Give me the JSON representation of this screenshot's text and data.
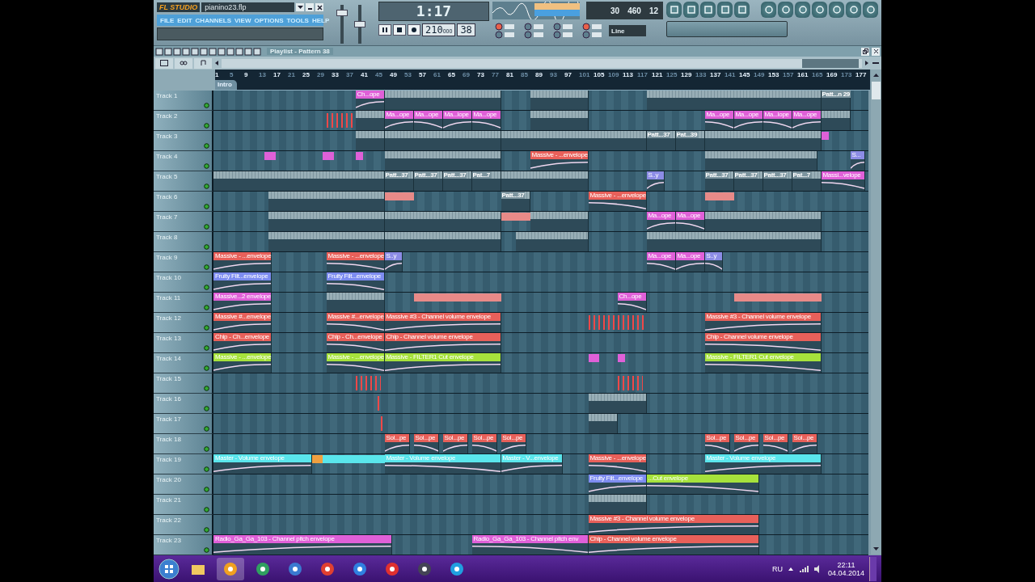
{
  "app": {
    "logo": "FL STUDIO",
    "file": "pianino23.flp",
    "menu": [
      "FILE",
      "EDIT",
      "CHANNELS",
      "VIEW",
      "OPTIONS",
      "TOOLS",
      "HELP"
    ]
  },
  "master": {
    "volume": {
      "level": 0.85
    },
    "pitch": {
      "level": 0.5
    }
  },
  "transport": {
    "song_position": "1:17",
    "tempo": "210",
    "tempo_fraction": "000",
    "pattern": "38"
  },
  "performance": {
    "readout_1": "30",
    "readout_2": "460",
    "readout_3": "12"
  },
  "snap": "Line",
  "playlist": {
    "title": "Playlist - Pattern 38",
    "ruler": [
      "1",
      "5",
      "9",
      "13",
      "17",
      "21",
      "25",
      "29",
      "33",
      "37",
      "41",
      "45",
      "49",
      "53",
      "57",
      "61",
      "65",
      "69",
      "73",
      "77",
      "81",
      "85",
      "89",
      "93",
      "97",
      "101",
      "105",
      "109",
      "113",
      "117",
      "121",
      "125",
      "129",
      "133",
      "137",
      "141",
      "145",
      "149",
      "153",
      "157",
      "161",
      "165",
      "169",
      "173",
      "177"
    ],
    "markers": [
      {
        "label": "Intro"
      }
    ],
    "tracks": [
      {
        "name": "Track 1",
        "clips": [
          {
            "kind": "envelope",
            "label": "Ch...ope",
            "color": "#e060d8"
          },
          {
            "kind": "pattern"
          },
          {
            "kind": "pattern"
          },
          {
            "kind": "pattern"
          },
          {
            "kind": "pattern",
            "label": "Patt...n 29"
          }
        ]
      },
      {
        "name": "Track 2",
        "clips": [
          {
            "kind": "notes"
          },
          {
            "kind": "pattern"
          },
          {
            "kind": "envelope",
            "label": "Ma...ope",
            "color": "#e060d8"
          },
          {
            "kind": "envelope",
            "label": "Ma...ope",
            "color": "#e060d8"
          },
          {
            "kind": "envelope",
            "label": "Ma...lope",
            "color": "#e060d8"
          },
          {
            "kind": "envelope",
            "label": "Ma...ope",
            "color": "#e060d8"
          },
          {
            "kind": "pattern"
          },
          {
            "kind": "envelope",
            "label": "Ma...ope",
            "color": "#e060d8"
          },
          {
            "kind": "envelope",
            "label": "Ma...ope",
            "color": "#e060d8"
          },
          {
            "kind": "envelope",
            "label": "Ma...lope",
            "color": "#e060d8"
          },
          {
            "kind": "envelope",
            "label": "Ma...ope",
            "color": "#e060d8"
          },
          {
            "kind": "pattern"
          }
        ]
      },
      {
        "name": "Track 3",
        "clips": [
          {
            "kind": "pattern"
          },
          {
            "kind": "pattern"
          },
          {
            "kind": "pattern"
          },
          {
            "kind": "pattern",
            "label": "Patt...37"
          },
          {
            "kind": "pattern",
            "label": "Pat...39"
          },
          {
            "kind": "pattern"
          },
          {
            "kind": "block",
            "color": "#e060d8"
          }
        ]
      },
      {
        "name": "Track 4",
        "clips": [
          {
            "kind": "block",
            "color": "#e060d8"
          },
          {
            "kind": "block",
            "color": "#e060d8"
          },
          {
            "kind": "block",
            "color": "#e060d8"
          },
          {
            "kind": "pattern"
          },
          {
            "kind": "envelope",
            "label": "Massive - ...envelope",
            "color": "#e8605a"
          },
          {
            "kind": "pattern"
          },
          {
            "kind": "envelope",
            "label": "S...",
            "color": "#8c8ce6"
          }
        ]
      },
      {
        "name": "Track 5",
        "clips": [
          {
            "kind": "pattern"
          },
          {
            "kind": "pattern",
            "label": "Patt...37"
          },
          {
            "kind": "pattern",
            "label": "Patt...37"
          },
          {
            "kind": "pattern",
            "label": "Patt...37"
          },
          {
            "kind": "pattern",
            "label": "Pat...7"
          },
          {
            "kind": "pattern"
          },
          {
            "kind": "envelope",
            "label": "S..y",
            "color": "#8c8ce6"
          },
          {
            "kind": "pattern",
            "label": "Patt...37"
          },
          {
            "kind": "pattern",
            "label": "Patt...37"
          },
          {
            "kind": "pattern",
            "label": "Patt...37"
          },
          {
            "kind": "pattern",
            "label": "Pat...7"
          },
          {
            "kind": "envelope",
            "label": "Massi...velope",
            "color": "#e060d8"
          }
        ]
      },
      {
        "name": "Track 6",
        "clips": [
          {
            "kind": "pattern"
          },
          {
            "kind": "block",
            "color": "#e88a88"
          },
          {
            "kind": "pattern",
            "label": "Patt...37"
          },
          {
            "kind": "envelope",
            "label": "Massive - ...envelope",
            "color": "#e8605a"
          },
          {
            "kind": "block",
            "color": "#e88a88"
          }
        ]
      },
      {
        "name": "Track 7",
        "clips": [
          {
            "kind": "pattern"
          },
          {
            "kind": "pattern"
          },
          {
            "kind": "block",
            "color": "#e88a88"
          },
          {
            "kind": "pattern"
          },
          {
            "kind": "envelope",
            "label": "Ma...ope",
            "color": "#e060d8"
          },
          {
            "kind": "envelope",
            "label": "Ma...ope",
            "color": "#e060d8"
          },
          {
            "kind": "pattern"
          }
        ]
      },
      {
        "name": "Track 8",
        "clips": [
          {
            "kind": "pattern"
          },
          {
            "kind": "pattern"
          },
          {
            "kind": "pattern"
          },
          {
            "kind": "pattern"
          }
        ]
      },
      {
        "name": "Track 9",
        "clips": [
          {
            "kind": "envelope",
            "label": "Massive - ...envelope",
            "color": "#e8605a"
          },
          {
            "kind": "envelope",
            "label": "Massive - ...envelope",
            "color": "#e8605a"
          },
          {
            "kind": "envelope",
            "label": "S..y",
            "color": "#8c8ce6"
          },
          {
            "kind": "envelope",
            "label": "Ma...ope",
            "color": "#e060d8"
          },
          {
            "kind": "envelope",
            "label": "Ma...ope",
            "color": "#e060d8"
          },
          {
            "kind": "envelope",
            "label": "S..y",
            "color": "#8c8ce6"
          }
        ]
      },
      {
        "name": "Track 10",
        "clips": [
          {
            "kind": "envelope",
            "label": "Fruity Filt...envelope",
            "color": "#7d8cf0"
          },
          {
            "kind": "envelope",
            "label": "Fruity Filt...envelope",
            "color": "#7d8cf0"
          }
        ]
      },
      {
        "name": "Track 11",
        "clips": [
          {
            "kind": "envelope",
            "label": "Massive...2 envelope",
            "color": "#e060d8"
          },
          {
            "kind": "pattern"
          },
          {
            "kind": "block",
            "color": "#e88a88"
          },
          {
            "kind": "block",
            "color": "#e88a88"
          },
          {
            "kind": "block",
            "color": "#e88a88"
          },
          {
            "kind": "envelope",
            "label": "Ch...ope",
            "color": "#e060d8"
          },
          {
            "kind": "block",
            "color": "#e88a88"
          },
          {
            "kind": "block",
            "color": "#e88a88"
          },
          {
            "kind": "block",
            "color": "#e88a88"
          }
        ]
      },
      {
        "name": "Track 12",
        "clips": [
          {
            "kind": "envelope",
            "label": "Massive #...envelope",
            "color": "#e8605a"
          },
          {
            "kind": "envelope",
            "label": "Massive #...envelope",
            "color": "#e8605a"
          },
          {
            "kind": "envelope",
            "label": "Massive #3 - Channel volume envelope",
            "color": "#e8605a"
          },
          {
            "kind": "notes"
          },
          {
            "kind": "envelope",
            "label": "Massive #3 - Channel volume envelope",
            "color": "#e8605a"
          }
        ]
      },
      {
        "name": "Track 13",
        "clips": [
          {
            "kind": "envelope",
            "label": "Chip - Ch...envelope",
            "color": "#e8605a"
          },
          {
            "kind": "envelope",
            "label": "Chip - Ch...envelope",
            "color": "#e8605a"
          },
          {
            "kind": "envelope",
            "label": "Chip - Channel volume envelope",
            "color": "#e8605a"
          },
          {
            "kind": "envelope",
            "label": "Chip - Channel volume envelope",
            "color": "#e8605a"
          }
        ]
      },
      {
        "name": "Track 14",
        "clips": [
          {
            "kind": "envelope",
            "label": "Massive - ...envelope",
            "color": "#a6e23c"
          },
          {
            "kind": "envelope",
            "label": "Massive - ...envelope",
            "color": "#a6e23c"
          },
          {
            "kind": "envelope",
            "label": "Massive - FILTER1 Cut envelope",
            "color": "#a6e23c"
          },
          {
            "kind": "block",
            "color": "#e060d8"
          },
          {
            "kind": "block",
            "color": "#e060d8"
          },
          {
            "kind": "envelope",
            "label": "Massive - FILTER1 Cut envelope",
            "color": "#a6e23c"
          }
        ]
      },
      {
        "name": "Track 15",
        "clips": [
          {
            "kind": "notes"
          },
          {
            "kind": "notes"
          }
        ]
      },
      {
        "name": "Track 16",
        "clips": [
          {
            "kind": "notes"
          },
          {
            "kind": "pattern"
          }
        ]
      },
      {
        "name": "Track 17",
        "clips": [
          {
            "kind": "notes"
          },
          {
            "kind": "pattern"
          }
        ]
      },
      {
        "name": "Track 18",
        "clips": [
          {
            "kind": "envelope",
            "label": "Sol...pe",
            "color": "#e8605a"
          },
          {
            "kind": "envelope",
            "label": "Sol...pe",
            "color": "#e8605a"
          },
          {
            "kind": "envelope",
            "label": "Sol...pe",
            "color": "#e8605a"
          },
          {
            "kind": "envelope",
            "label": "Sol...pe",
            "color": "#e8605a"
          },
          {
            "kind": "envelope",
            "label": "Sol...pe",
            "color": "#e8605a"
          },
          {
            "kind": "envelope",
            "label": "Sol...pe",
            "color": "#e8605a"
          },
          {
            "kind": "envelope",
            "label": "Sol...pe",
            "color": "#e8605a"
          },
          {
            "kind": "envelope",
            "label": "Sol...pe",
            "color": "#e8605a"
          },
          {
            "kind": "envelope",
            "label": "Sol...pe",
            "color": "#e8605a"
          }
        ]
      },
      {
        "name": "Track 19",
        "clips": [
          {
            "kind": "envelope",
            "label": "Master - Volume envelope",
            "color": "#5ae6ec"
          },
          {
            "kind": "block",
            "color": "#f0a040"
          },
          {
            "kind": "block",
            "color": "#5ae6ec"
          },
          {
            "kind": "envelope",
            "label": "Master - Volume envelope",
            "color": "#5ae6ec"
          },
          {
            "kind": "envelope",
            "label": "Master - V...envelope",
            "color": "#5ae6ec"
          },
          {
            "kind": "envelope",
            "label": "Massive - ...envelope",
            "color": "#e8605a"
          },
          {
            "kind": "envelope",
            "label": "Master - Volume envelope",
            "color": "#5ae6ec"
          }
        ]
      },
      {
        "name": "Track 20",
        "clips": [
          {
            "kind": "envelope",
            "label": "Fruity Filt...envelope",
            "color": "#7d8cf0"
          },
          {
            "kind": "envelope",
            "label": "...Cut envelope",
            "color": "#a6e23c"
          }
        ]
      },
      {
        "name": "Track 21",
        "clips": [
          {
            "kind": "pattern"
          }
        ]
      },
      {
        "name": "Track 22",
        "clips": [
          {
            "kind": "envelope",
            "label": "Massive #3 - Channel volume envelope",
            "color": "#e8605a"
          }
        ]
      },
      {
        "name": "Track 23",
        "clips": [
          {
            "kind": "envelope",
            "label": "Radio_Ga_Ga_103 - Channel pitch envelope",
            "color": "#e060d8"
          },
          {
            "kind": "envelope",
            "label": "Radio_Ga_Ga_103 - Channel pitch env",
            "color": "#e060d8"
          },
          {
            "kind": "envelope",
            "label": "Chip - Channel volume envelope",
            "color": "#e8605a"
          }
        ]
      }
    ]
  },
  "taskbar": {
    "language": "RU",
    "time": "22:11",
    "date": "04.04.2014"
  }
}
